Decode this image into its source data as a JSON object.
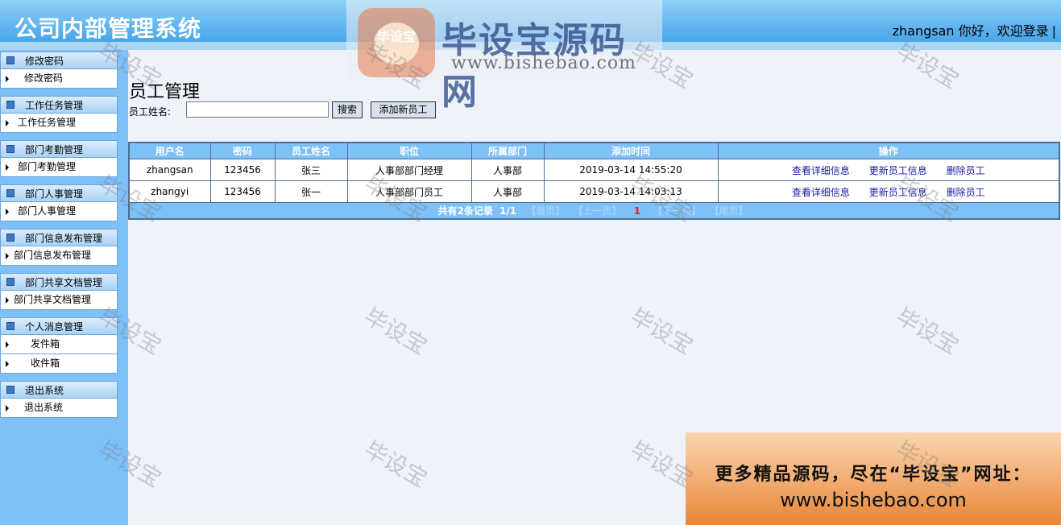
{
  "header": {
    "title": "公司内部管理系统",
    "welcome": "zhangsan 你好，欢迎登录",
    "separator": "|"
  },
  "watermark": {
    "logo_text": "毕设宝",
    "site_name": "毕设宝源码网",
    "site_url": "www.bishebao.com",
    "tile_text": "毕设宝"
  },
  "sidebar": {
    "groups": [
      {
        "title": "修改密码",
        "items": [
          "修改密码"
        ]
      },
      {
        "title": "工作任务管理",
        "items": [
          "工作任务管理"
        ]
      },
      {
        "title": "部门考勤管理",
        "items": [
          "部门考勤管理"
        ]
      },
      {
        "title": "部门人事管理",
        "items": [
          "部门人事管理"
        ]
      },
      {
        "title": "部门信息发布管理",
        "items": [
          "部门信息发布管理"
        ]
      },
      {
        "title": "部门共享文档管理",
        "items": [
          "部门共享文档管理"
        ]
      },
      {
        "title": "个人消息管理",
        "items": [
          "发件箱",
          "收件箱"
        ]
      },
      {
        "title": "退出系统",
        "items": [
          "退出系统"
        ]
      }
    ]
  },
  "main": {
    "page_title": "员工管理",
    "search_label": "员工姓名:",
    "search_value": "",
    "search_button": "搜索",
    "add_button": "添加新员工",
    "table": {
      "columns": [
        "用户名",
        "密码",
        "员工姓名",
        "职位",
        "所属部门",
        "添加时间",
        "操作"
      ],
      "rows": [
        {
          "username": "zhangsan",
          "password": "123456",
          "name": "张三",
          "position": "人事部部门经理",
          "dept": "人事部",
          "added": "2019-03-14 14:55:20"
        },
        {
          "username": "zhangyi",
          "password": "123456",
          "name": "张一",
          "position": "人事部部门员工",
          "dept": "人事部",
          "added": "2019-03-14 14:03:13"
        }
      ],
      "actions": [
        "查看详细信息",
        "更新员工信息",
        "删除员工"
      ]
    },
    "pager": {
      "total": "共有2条记录",
      "pages": "1/1",
      "first": "【首页】",
      "prev": "【上一页】",
      "current": "1",
      "next": "【下一页】",
      "last": "【尾页】"
    }
  },
  "promo": {
    "line1": "更多精品源码，尽在“毕设宝”网址：",
    "line2": "www.bishebao.com"
  },
  "colors": {
    "header_blue": "#3d9de6",
    "sidebar_blue": "#7ec0f8",
    "table_header": "#7ec0f8",
    "link": "#1a1aa6",
    "page_current": "#e02020"
  }
}
